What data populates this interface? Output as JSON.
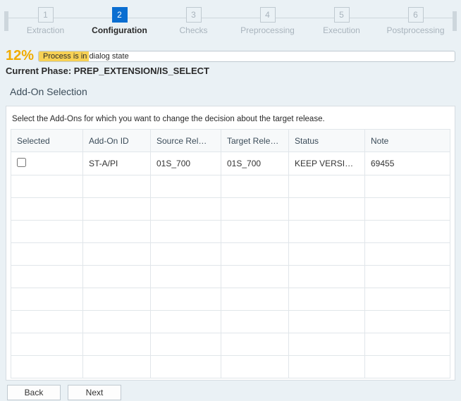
{
  "stepper": {
    "steps": [
      {
        "num": "1",
        "label": "Extraction"
      },
      {
        "num": "2",
        "label": "Configuration"
      },
      {
        "num": "3",
        "label": "Checks"
      },
      {
        "num": "4",
        "label": "Preprocessing"
      },
      {
        "num": "5",
        "label": "Execution"
      },
      {
        "num": "6",
        "label": "Postprocessing"
      }
    ],
    "active_index": 1
  },
  "progress": {
    "percent_label": "12%",
    "percent_value": 12,
    "status_text": "Process is in dialog state"
  },
  "phase": {
    "label": "Current Phase: PREP_EXTENSION/IS_SELECT"
  },
  "section": {
    "title": "Add-On Selection"
  },
  "panel": {
    "hint": "Select the Add-Ons for which you want to change the decision about the target release."
  },
  "table": {
    "columns": {
      "selected": "Selected",
      "addon_id": "Add-On ID",
      "source_rel": "Source Rel…",
      "target_rel": "Target Rele…",
      "status": "Status",
      "note": "Note"
    },
    "rows": [
      {
        "selected": false,
        "addon_id": "ST-A/PI",
        "source_rel": "01S_700",
        "target_rel": "01S_700",
        "status": "KEEP VERSI…",
        "note": "69455"
      }
    ],
    "empty_row_count": 9
  },
  "footer": {
    "back": "Back",
    "next": "Next"
  }
}
